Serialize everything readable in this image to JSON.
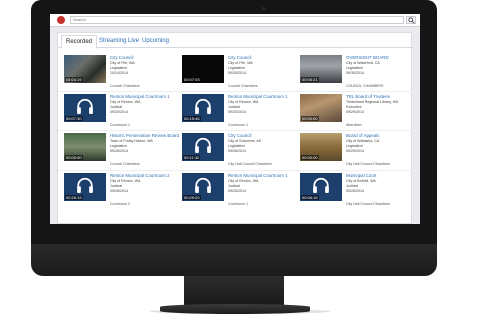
{
  "search": {
    "placeholder": "Search"
  },
  "tabs": [
    {
      "label": "Recorded"
    },
    {
      "label": "Streaming Live"
    },
    {
      "label": "Upcoming"
    }
  ],
  "cards": [
    {
      "title": "City Council",
      "city": "City of Fife, WA",
      "type": "Legislative",
      "date": "10/14/2014",
      "location": "Council Chambers",
      "duration": "04:04:19",
      "thumb": "video1"
    },
    {
      "title": "City Council",
      "city": "City of Fife, WA",
      "type": "Legislative",
      "date": "09/30/2014",
      "location": "Council Chambers",
      "duration": "00:07:03",
      "thumb": "black"
    },
    {
      "title": "OVERSIGHT BOARD",
      "city": "City of Waterford, CA",
      "type": "Legislative",
      "date": "09/30/2014",
      "location": "COUNCIL CHAMBERS",
      "duration": "00:06:21",
      "thumb": "video2"
    },
    {
      "title": "Renton Municipal Courtroom 1",
      "city": "City of Renton, WA",
      "type": "Judicial",
      "date": "09/30/2014",
      "location": "Courtroom 1",
      "duration": "00:07:30",
      "thumb": "audio"
    },
    {
      "title": "Renton Municipal Courtroom 1",
      "city": "City of Renton, WA",
      "type": "Judicial",
      "date": "09/30/2014",
      "location": "Courtroom 1",
      "duration": "00:15:46",
      "thumb": "audio"
    },
    {
      "title": "TRL Board of Trustees",
      "city": "Timberland Regional Library, WA",
      "type": "Executive",
      "date": "09/29/2014",
      "location": "Aberdeen",
      "duration": "00:00:00",
      "thumb": "video3"
    },
    {
      "title": "Historic Preservation Review Board",
      "city": "Town of Friday Harbor, WA",
      "type": "Legislative",
      "date": "09/26/2014",
      "location": "Council Chambers",
      "duration": "00:00:00",
      "thumb": "video4"
    },
    {
      "title": "City Council",
      "city": "City of Sotomme, AK",
      "type": "Legislative",
      "date": "09/26/2014",
      "location": "City Hall Council Chambers",
      "duration": "00:11:32",
      "thumb": "audio"
    },
    {
      "title": "Board of Appeals",
      "city": "City of Wabasha, CA",
      "type": "Legislative",
      "date": "09/29/2014",
      "location": "City Hall Council Chambers",
      "duration": "00:00:00",
      "thumb": "video5"
    },
    {
      "title": "Renton Municipal Courtroom 2",
      "city": "City of Renton, WA",
      "type": "Judicial",
      "date": "09/26/2014",
      "location": "Courtroom 2",
      "duration": "00:26:19",
      "thumb": "audio"
    },
    {
      "title": "Renton Municipal Courtroom 1",
      "city": "City of Renton, WA",
      "type": "Judicial",
      "date": "09/26/2014",
      "location": "Courtroom 1",
      "duration": "00:29:20",
      "thumb": "audio"
    },
    {
      "title": "Municipal Court",
      "city": "City of Bothell, WA",
      "type": "Judicial",
      "date": "09/28/2014",
      "location": "City Hall Council Chambers",
      "duration": "00:06:16",
      "thumb": "audio"
    }
  ],
  "colors": {
    "accent": "#2d6fb5",
    "logo": "#c5312b",
    "audio_bg": "#1d3f6b"
  },
  "icons": {
    "audio": "headphones-icon",
    "search": "search-icon"
  }
}
